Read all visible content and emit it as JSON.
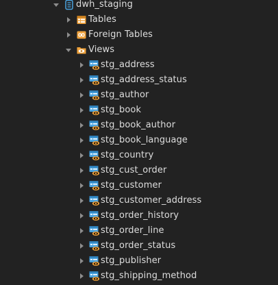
{
  "database": {
    "name": "dwh_staging",
    "icon": "database-icon",
    "expanded": true
  },
  "groups": [
    {
      "key": "tables",
      "label": "Tables",
      "icon": "tables-icon",
      "expanded": false
    },
    {
      "key": "foreign-tables",
      "label": "Foreign Tables",
      "icon": "foreign-tables-icon",
      "expanded": false
    },
    {
      "key": "views",
      "label": "Views",
      "icon": "views-icon",
      "expanded": true
    }
  ],
  "views": [
    "stg_address",
    "stg_address_status",
    "stg_author",
    "stg_book",
    "stg_book_author",
    "stg_book_language",
    "stg_country",
    "stg_cust_order",
    "stg_customer",
    "stg_customer_address",
    "stg_order_history",
    "stg_order_line",
    "stg_order_status",
    "stg_publisher",
    "stg_shipping_method"
  ],
  "view_icon": "view-icon",
  "colors": {
    "background": "#222222",
    "text": "#dedede",
    "caret": "#8d8d8d",
    "database_icon": "#4aa3df",
    "folder_icon": "#f0a23b",
    "view_icon_table": "#4aa3df",
    "view_icon_eye": "#f0a23b"
  }
}
